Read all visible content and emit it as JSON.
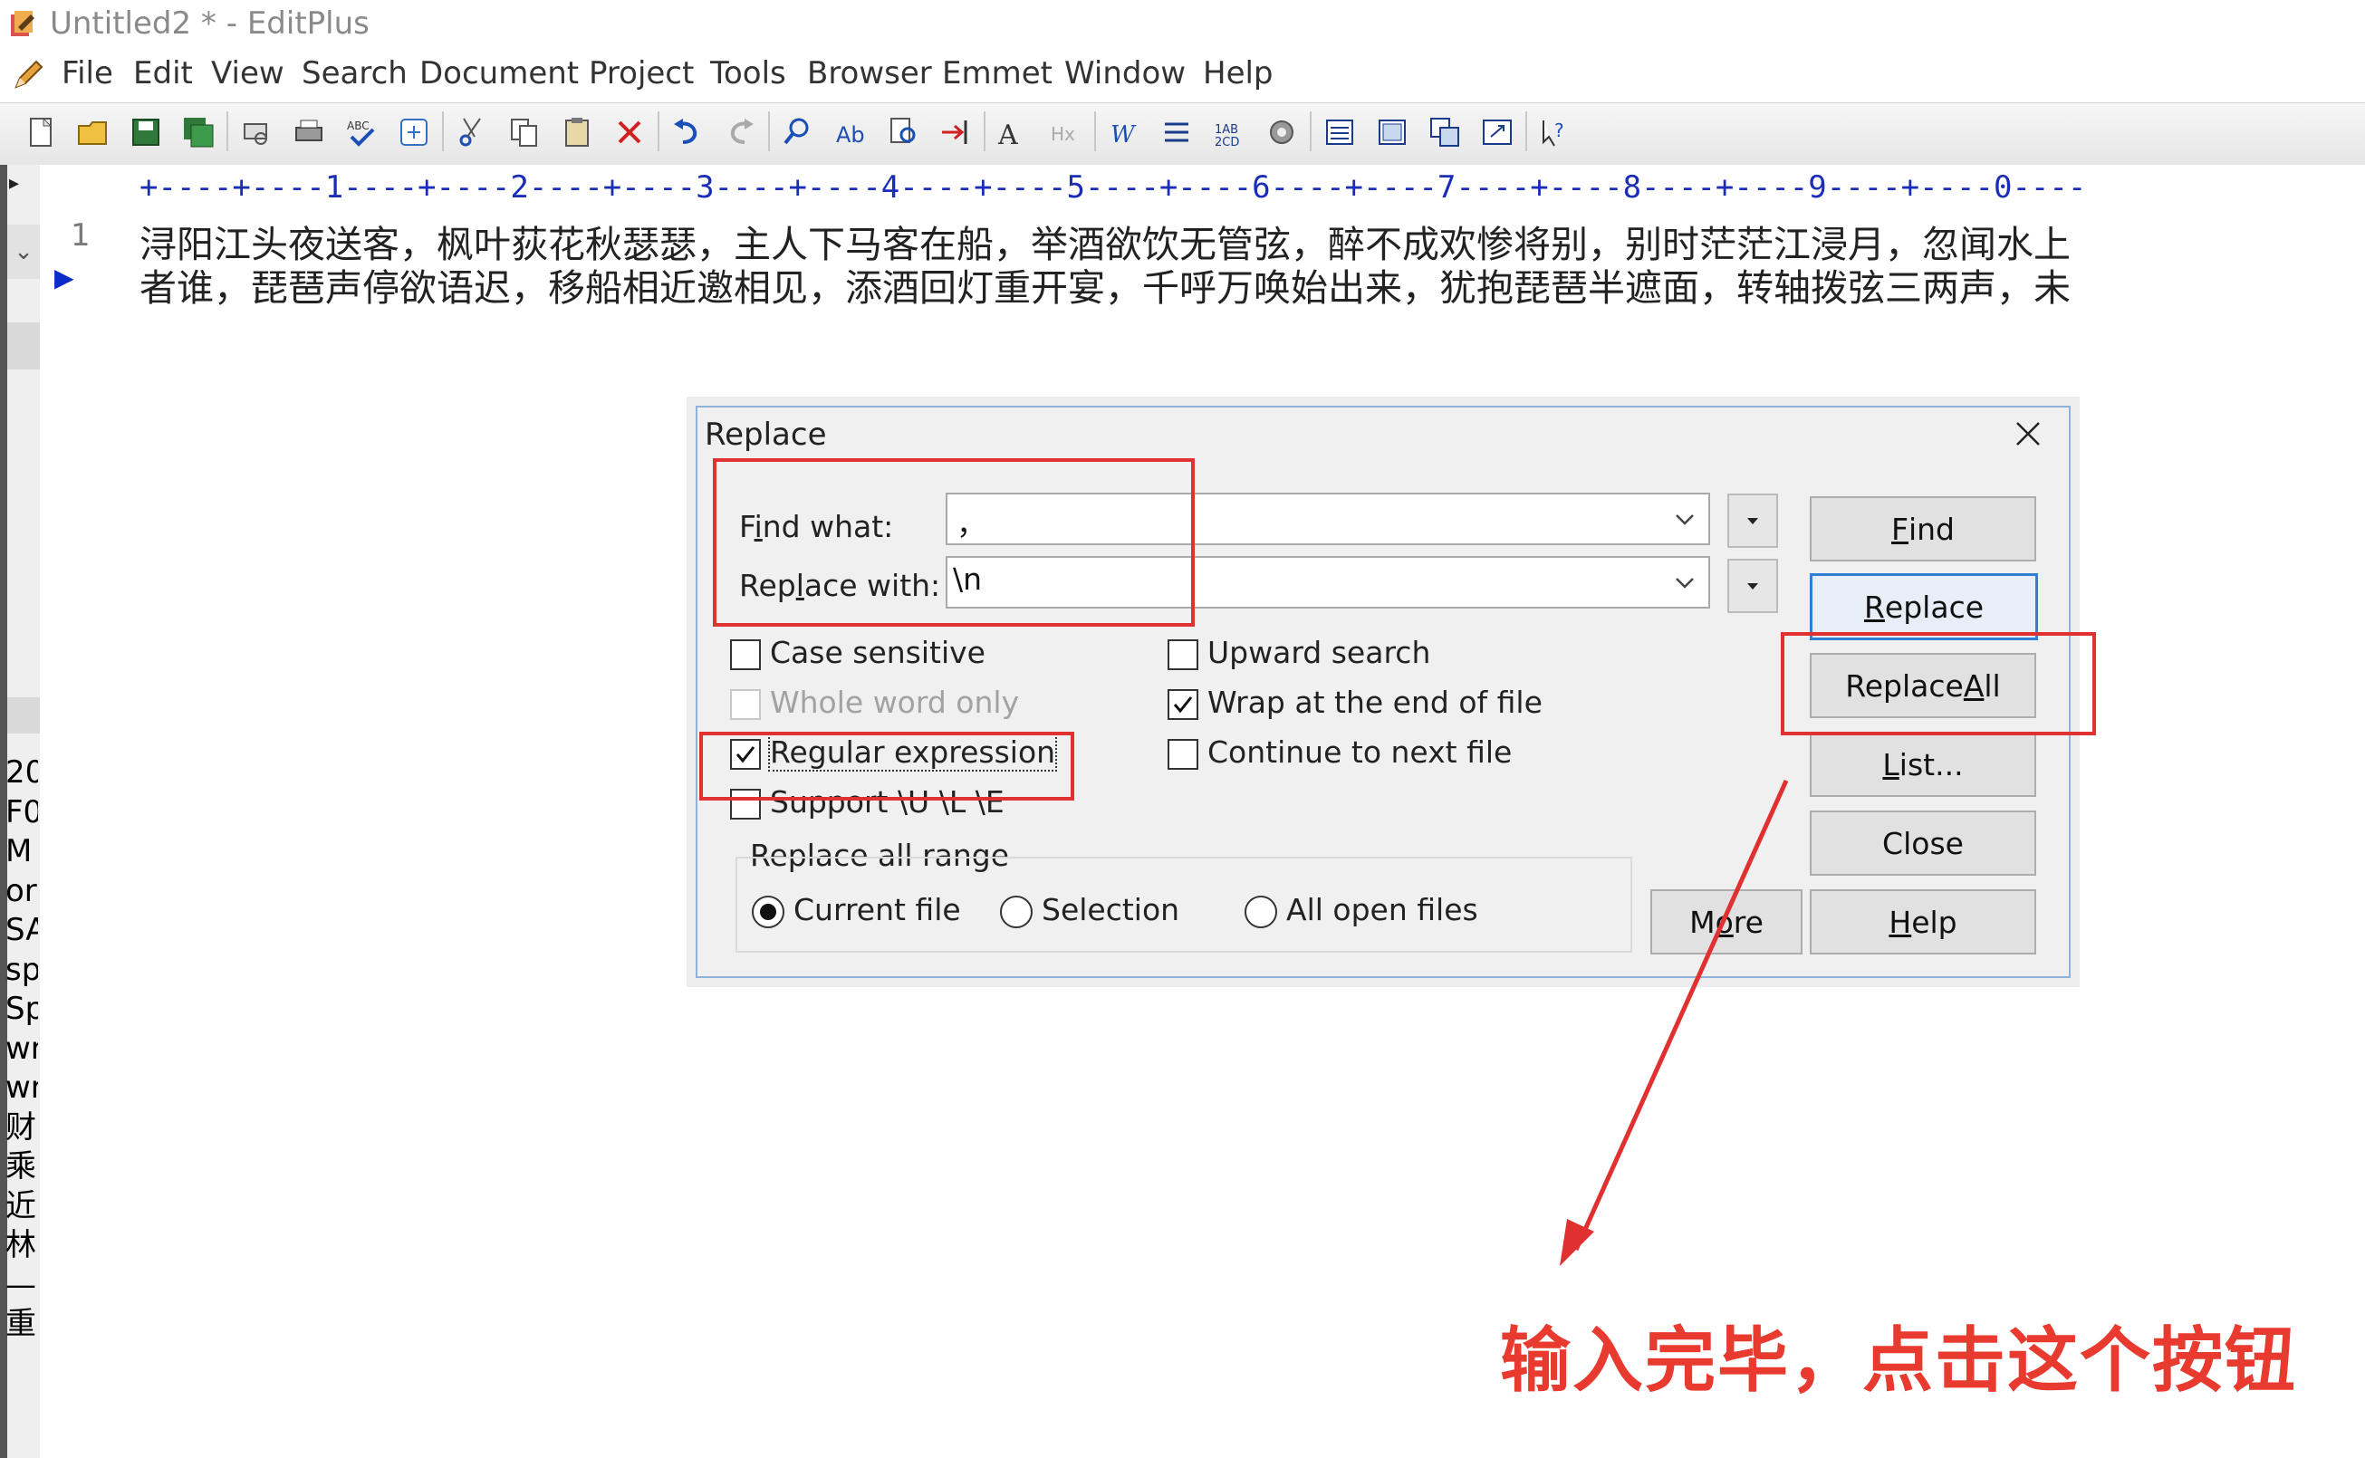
{
  "window": {
    "title": "Untitled2 * - EditPlus"
  },
  "menu": [
    "File",
    "Edit",
    "View",
    "Search",
    "Document",
    "Project",
    "Tools",
    "Browser",
    "Emmet",
    "Window",
    "Help"
  ],
  "toolbar": {
    "icons": [
      "new-file-icon",
      "open-folder-icon",
      "save-icon",
      "save-all-icon",
      "print-preview-icon",
      "print-icon",
      "spellcheck-icon",
      "browser-preview-icon",
      "cut-icon",
      "copy-icon",
      "paste-icon",
      "delete-icon",
      "undo-icon",
      "redo-icon",
      "find-icon",
      "replace-icon",
      "find-in-files-icon",
      "goto-icon",
      "font-icon",
      "hex-icon",
      "word-wrap-icon",
      "line-number-icon",
      "column-icon",
      "settings-icon",
      "window-list-icon",
      "tile-icon",
      "cascade-icon",
      "full-screen-icon",
      "help-icon"
    ]
  },
  "ruler": {
    "text": "+----+----1----+----2----+----3----+----4----+----5----+----6----+----7----+----8----+----9----+----0----"
  },
  "editor": {
    "line_number": "1",
    "line1": "浔阳江头夜送客，枫叶荻花秋瑟瑟，主人下马客在船，举酒欲饮无管弦，醉不成欢惨将别，别时茫茫江浸月，忽闻水上",
    "line2": "者谁，琵琶声停欲语迟，移船相近邀相见，添酒回灯重开宴，千呼万唤始出来，犹抱琵琶半遮面，转轴拨弦三两声，未"
  },
  "side_panel": {
    "lines": [
      "20",
      "F0",
      "M",
      "or",
      "SA",
      "sp",
      "Sp",
      "wr",
      "wr",
      "财",
      "乘",
      "近",
      "林",
      "—",
      "重"
    ]
  },
  "dialog": {
    "title": "Replace",
    "find_label": "Find what:",
    "find_value": "，",
    "replace_label": "Replace with:",
    "replace_value": "\\n",
    "options": {
      "case_sensitive": {
        "label": "Case sensitive",
        "checked": false
      },
      "whole_word": {
        "label": "Whole word only",
        "checked": false,
        "disabled": true
      },
      "regex": {
        "label": "Regular expression",
        "checked": true
      },
      "support_ule": {
        "label": "Support \\U \\L \\E",
        "checked": false
      },
      "upward": {
        "label": "Upward search",
        "checked": false
      },
      "wrap": {
        "label": "Wrap at the end of file",
        "checked": true
      },
      "continue_next": {
        "label": "Continue to next file",
        "checked": false
      }
    },
    "range": {
      "label": "Replace all range",
      "current_file": "Current file",
      "selection": "Selection",
      "all_open": "All open files",
      "selected": "current_file"
    },
    "buttons": {
      "find": "Find",
      "replace": "Replace",
      "replace_all": "Replace All",
      "list": "List...",
      "close": "Close",
      "more": "More",
      "help": "Help"
    }
  },
  "annotation": {
    "text": "输入完毕，点击这个按钮",
    "color": "#e83a2e"
  }
}
